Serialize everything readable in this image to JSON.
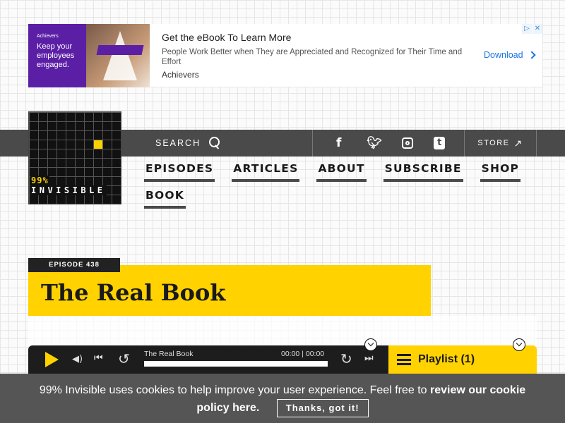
{
  "ad": {
    "brand": "Achievers",
    "tagline": "Keep your employees engaged.",
    "title": "Get the eBook To Learn More",
    "description": "People Work Better when They are Appreciated and Recognized for Their Time and Effort",
    "advertiser": "Achievers",
    "cta": "Download",
    "adchoices_icon": "adchoices-icon",
    "close_icon": "close-icon"
  },
  "logo": {
    "percent": "99%",
    "name": "INVISIBLE",
    "accent": "#f9d100"
  },
  "header": {
    "search_label": "SEARCH",
    "social": [
      "facebook-icon",
      "twitter-icon",
      "instagram-icon",
      "tumblr-icon"
    ],
    "store_label": "STORE"
  },
  "nav": {
    "items": [
      "EPISODES",
      "ARTICLES",
      "ABOUT",
      "SUBSCRIBE",
      "SHOP",
      "BOOK"
    ]
  },
  "episode": {
    "label": "EPISODE 438",
    "title": "The Real Book"
  },
  "player": {
    "track_title": "The Real Book",
    "current_time": "00:00",
    "duration": "00:00",
    "progress": 0,
    "playlist_label": "Playlist (1)"
  },
  "cookie": {
    "text": "99% Invisible uses cookies to help improve your user experience. Feel free to ",
    "link": "review our cookie policy here.",
    "button": "Thanks, got it!"
  },
  "colors": {
    "brand_yellow": "#ffd200",
    "nav_bar": "#4a4a4a",
    "player_bg": "#1d1d1d"
  }
}
